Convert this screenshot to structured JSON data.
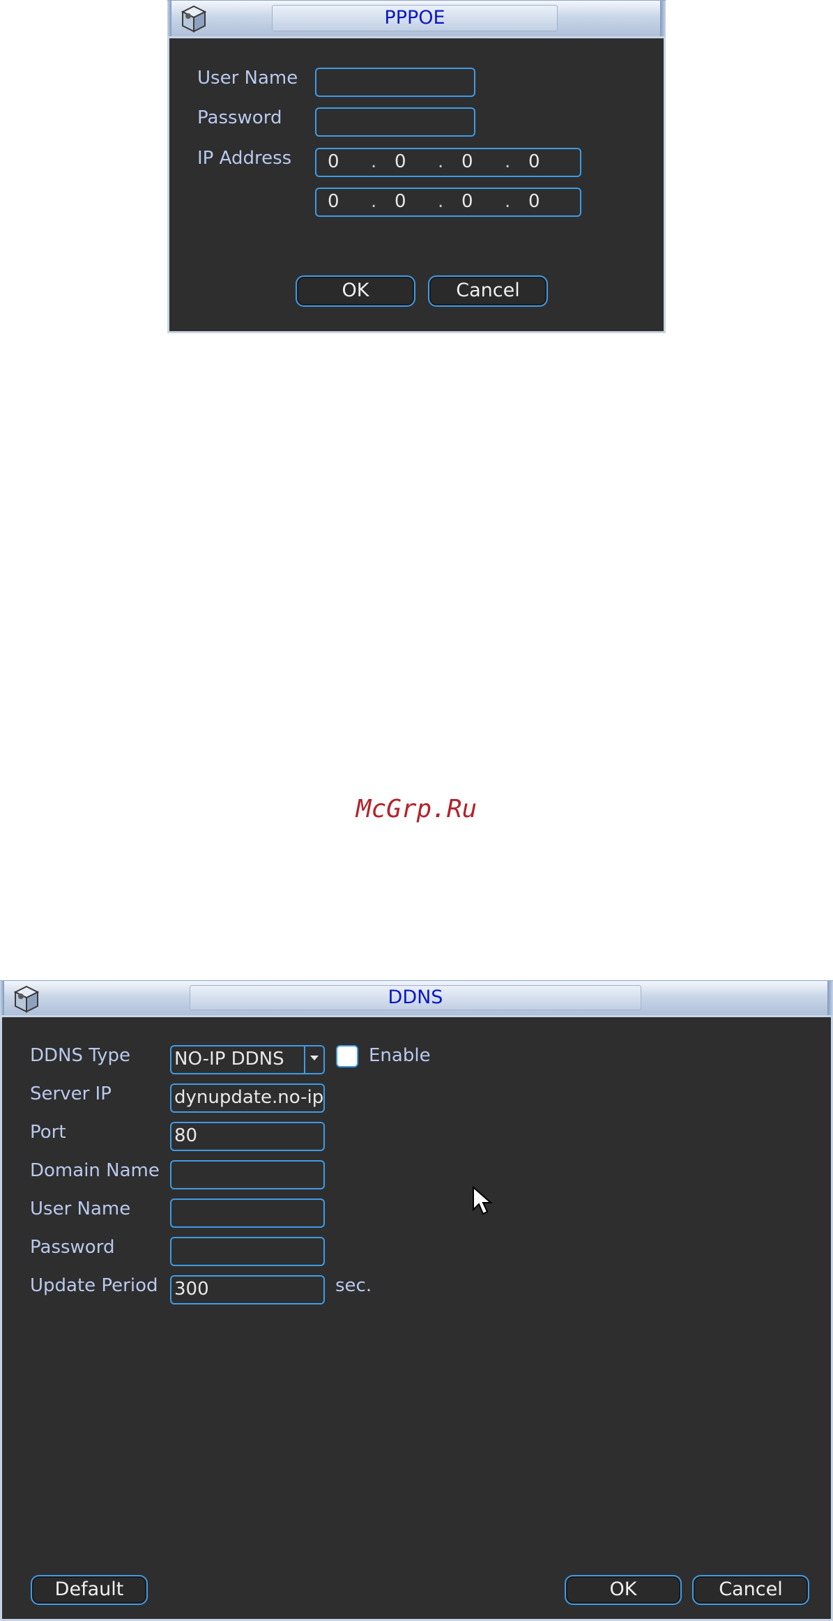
{
  "pppoe": {
    "title": "PPPOE",
    "user_name_label": "User Name",
    "password_label": "Password",
    "ip_address_label": "IP Address",
    "ip_address_1": [
      "0",
      "0",
      "0",
      "0"
    ],
    "ip_address_2": [
      "0",
      "0",
      "0",
      "0"
    ],
    "ok_label": "OK",
    "cancel_label": "Cancel"
  },
  "watermark": "McGrp.Ru",
  "ddns": {
    "title": "DDNS",
    "ddns_type_label": "DDNS Type",
    "ddns_type_value": "NO-IP DDNS",
    "enable_label": "Enable",
    "server_ip_label": "Server IP",
    "server_ip_value": "dynupdate.no-ip",
    "port_label": "Port",
    "port_value": "80",
    "domain_name_label": "Domain Name",
    "user_name_label": "User Name",
    "password_label": "Password",
    "update_period_label": "Update Period",
    "update_period_value": "300",
    "update_period_unit": "sec.",
    "default_label": "Default",
    "ok_label": "OK",
    "cancel_label": "Cancel"
  },
  "icons": {
    "app_icon": "cube-config-icon",
    "pointer": "mouse-cursor-icon"
  },
  "colors": {
    "title_text": "#0b17c6",
    "label": "#b9c9ee",
    "field_border": "#3f9be6",
    "panel_bg": "#2e2e2e",
    "watermark": "#b2232b"
  }
}
